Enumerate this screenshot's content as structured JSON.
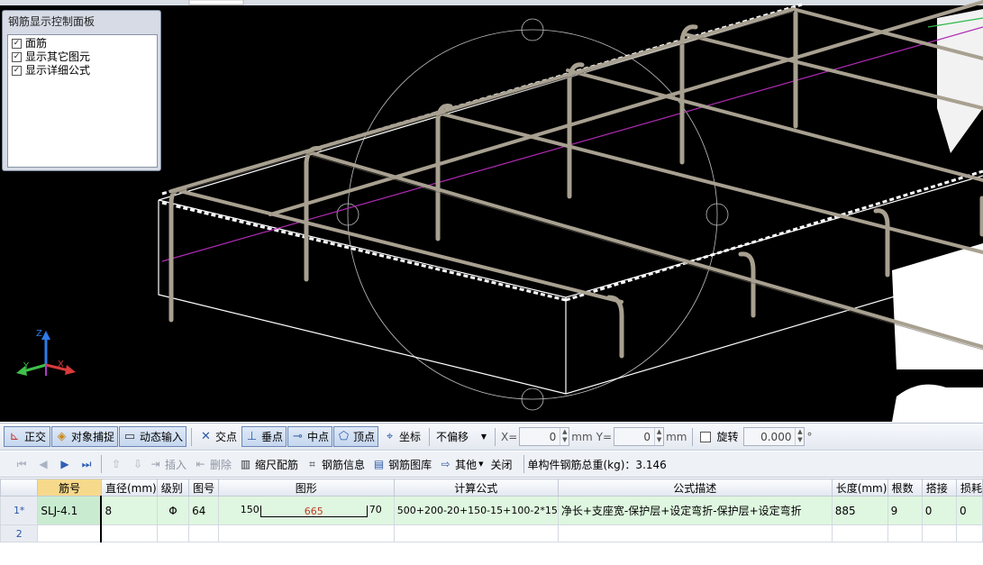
{
  "control_panel": {
    "title": "钢筋显示控制面板",
    "options": [
      {
        "label": "面筋",
        "checked": true
      },
      {
        "label": "显示其它图元",
        "checked": true
      },
      {
        "label": "显示详细公式",
        "checked": true
      }
    ]
  },
  "axis": {
    "z": "Z",
    "y": "Y",
    "x": "X"
  },
  "toolbar1": {
    "orthogonal": "正交",
    "object_snap": "对象捕捉",
    "dynamic_input": "动态输入",
    "intersection": "交点",
    "perpendicular": "垂点",
    "midpoint": "中点",
    "vertex": "顶点",
    "coordinate": "坐标",
    "offset_select": "不偏移",
    "x_label": "X=",
    "x_value": "0",
    "mm1": "mm",
    "y_label": "Y=",
    "y_value": "0",
    "mm2": "mm",
    "rotate_label": "旋转",
    "rotate_value": "0.000",
    "degree": "°"
  },
  "toolbar2": {
    "insert": "插入",
    "delete": "删除",
    "scale_rebar": "缩尺配筋",
    "rebar_info": "钢筋信息",
    "rebar_library": "钢筋图库",
    "other": "其他",
    "close": "关闭",
    "total_weight": "单构件钢筋总重(kg)：3.146"
  },
  "grid": {
    "columns": [
      "筋号",
      "直径(mm)",
      "级别",
      "图号",
      "图形",
      "计算公式",
      "公式描述",
      "长度(mm)",
      "根数",
      "搭接",
      "损耗"
    ],
    "rows": [
      {
        "row_no": "1*",
        "bar_no": "SLJ-4.1",
        "diameter": "8",
        "grade": "Φ",
        "shape_no": "64",
        "shape": {
          "left": "150",
          "mid": "665",
          "right": "70"
        },
        "formula": "500+200-20+150-15+100-2*15",
        "description": "净长+支座宽-保护层+设定弯折-保护层+设定弯折",
        "length": "885",
        "count": "9",
        "lap": "0",
        "loss": "0"
      },
      {
        "row_no": "2"
      }
    ]
  }
}
